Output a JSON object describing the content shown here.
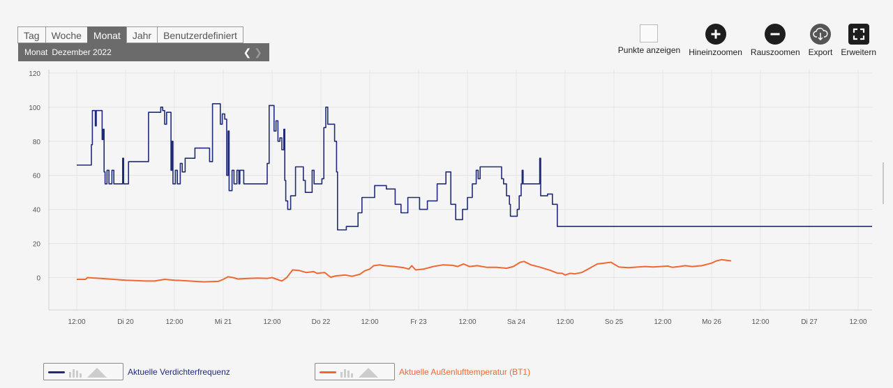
{
  "tabs": [
    "Tag",
    "Woche",
    "Monat",
    "Jahr",
    "Benutzerdefiniert"
  ],
  "active_tab": "Monat",
  "period": {
    "label": "Monat",
    "value": "Dezember 2022"
  },
  "tools": {
    "show_points": "Punkte anzeigen",
    "zoom_in": "Hineinzoomen",
    "zoom_out": "Rauszoomen",
    "export": "Export",
    "expand": "Erweitern"
  },
  "chart_data": {
    "type": "line",
    "y_ticks": [
      120,
      100,
      80,
      60,
      40,
      20,
      0
    ],
    "ylim": [
      -19,
      122
    ],
    "x_tick_labels": [
      "12:00",
      "Di 20",
      "12:00",
      "Mi 21",
      "12:00",
      "Do 22",
      "12:00",
      "Fr 23",
      "12:00",
      "Sa 24",
      "12:00",
      "So 25",
      "12:00",
      "Mo 26",
      "12:00",
      "Di 27",
      "12:00"
    ],
    "grid": true,
    "legend_position": "bottom-left",
    "series": [
      {
        "name": "Aktuelle Verdichterfrequenz",
        "color": "#1f2a78",
        "step": true,
        "points": [
          [
            0,
            66
          ],
          [
            0.26,
            66
          ],
          [
            0.3,
            78
          ],
          [
            0.32,
            98
          ],
          [
            0.36,
            98
          ],
          [
            0.38,
            89
          ],
          [
            0.4,
            98
          ],
          [
            0.5,
            98
          ],
          [
            0.52,
            81
          ],
          [
            0.54,
            87
          ],
          [
            0.56,
            62
          ],
          [
            0.58,
            55
          ],
          [
            0.62,
            63
          ],
          [
            0.66,
            55
          ],
          [
            0.72,
            63
          ],
          [
            0.76,
            55
          ],
          [
            0.92,
            55
          ],
          [
            0.94,
            70
          ],
          [
            0.96,
            55
          ],
          [
            1.02,
            55
          ],
          [
            1.06,
            68
          ],
          [
            1.45,
            68
          ],
          [
            1.47,
            97
          ],
          [
            1.7,
            97
          ],
          [
            1.72,
            100
          ],
          [
            1.76,
            98
          ],
          [
            1.8,
            90
          ],
          [
            1.84,
            97
          ],
          [
            1.9,
            97
          ],
          [
            1.93,
            63
          ],
          [
            1.95,
            80
          ],
          [
            1.97,
            55
          ],
          [
            2.02,
            63
          ],
          [
            2.06,
            55
          ],
          [
            2.12,
            67
          ],
          [
            2.16,
            62
          ],
          [
            2.22,
            70
          ],
          [
            2.4,
            70
          ],
          [
            2.42,
            76
          ],
          [
            2.68,
            76
          ],
          [
            2.72,
            68
          ],
          [
            2.76,
            68
          ],
          [
            2.78,
            102
          ],
          [
            2.92,
            102
          ],
          [
            2.94,
            90
          ],
          [
            2.98,
            96
          ],
          [
            3.03,
            93
          ],
          [
            3.07,
            60
          ],
          [
            3.1,
            86
          ],
          [
            3.12,
            51
          ],
          [
            3.18,
            63
          ],
          [
            3.22,
            55
          ],
          [
            3.28,
            63
          ],
          [
            3.32,
            55
          ],
          [
            3.34,
            63
          ],
          [
            3.38,
            63
          ],
          [
            3.42,
            55
          ],
          [
            3.88,
            55
          ],
          [
            3.9,
            67
          ],
          [
            3.94,
            101
          ],
          [
            4.0,
            101
          ],
          [
            4.04,
            86
          ],
          [
            4.08,
            92
          ],
          [
            4.12,
            80
          ],
          [
            4.16,
            82
          ],
          [
            4.2,
            75
          ],
          [
            4.24,
            87
          ],
          [
            4.26,
            57
          ],
          [
            4.28,
            45
          ],
          [
            4.32,
            40
          ],
          [
            4.38,
            48
          ],
          [
            4.46,
            48
          ],
          [
            4.48,
            65
          ],
          [
            4.62,
            65
          ],
          [
            4.64,
            57
          ],
          [
            4.68,
            50
          ],
          [
            4.8,
            50
          ],
          [
            4.82,
            63
          ],
          [
            4.86,
            55
          ],
          [
            5.0,
            55
          ],
          [
            5.02,
            58
          ],
          [
            5.06,
            88
          ],
          [
            5.1,
            100
          ],
          [
            5.14,
            90
          ],
          [
            5.24,
            90
          ],
          [
            5.28,
            80
          ],
          [
            5.32,
            62
          ],
          [
            5.34,
            28
          ],
          [
            5.5,
            28
          ],
          [
            5.52,
            30
          ],
          [
            5.74,
            30
          ],
          [
            5.76,
            38
          ],
          [
            5.84,
            47
          ],
          [
            6.06,
            47
          ],
          [
            6.1,
            54
          ],
          [
            6.32,
            54
          ],
          [
            6.34,
            52
          ],
          [
            6.5,
            52
          ],
          [
            6.52,
            43
          ],
          [
            6.62,
            43
          ],
          [
            6.64,
            38
          ],
          [
            6.76,
            38
          ],
          [
            6.78,
            47
          ],
          [
            7.0,
            47
          ],
          [
            7.02,
            40
          ],
          [
            7.16,
            40
          ],
          [
            7.18,
            45
          ],
          [
            7.36,
            45
          ],
          [
            7.38,
            55
          ],
          [
            7.54,
            55
          ],
          [
            7.56,
            62
          ],
          [
            7.64,
            62
          ],
          [
            7.66,
            43
          ],
          [
            7.74,
            43
          ],
          [
            7.76,
            34
          ],
          [
            7.88,
            34
          ],
          [
            7.9,
            40
          ],
          [
            7.98,
            40
          ],
          [
            8.0,
            47
          ],
          [
            8.08,
            47
          ],
          [
            8.1,
            55
          ],
          [
            8.16,
            55
          ],
          [
            8.18,
            63
          ],
          [
            8.22,
            58
          ],
          [
            8.26,
            65
          ],
          [
            8.68,
            65
          ],
          [
            8.7,
            58
          ],
          [
            8.74,
            55
          ],
          [
            8.8,
            48
          ],
          [
            8.86,
            43
          ],
          [
            8.88,
            36
          ],
          [
            8.98,
            36
          ],
          [
            9.02,
            40
          ],
          [
            9.06,
            48
          ],
          [
            9.1,
            55
          ],
          [
            9.12,
            63
          ],
          [
            9.14,
            55
          ],
          [
            9.46,
            55
          ],
          [
            9.48,
            70
          ],
          [
            9.5,
            48
          ],
          [
            9.62,
            48
          ],
          [
            9.64,
            49
          ],
          [
            9.72,
            49
          ],
          [
            9.74,
            43
          ],
          [
            9.82,
            43
          ],
          [
            9.84,
            30
          ],
          [
            9.98,
            30
          ]
        ]
      },
      {
        "name": "Aktuelle Außenlufttemperatur (BT1)",
        "color": "#f26730",
        "step": false,
        "points": [
          [
            0,
            -1
          ],
          [
            0.18,
            -1
          ],
          [
            0.22,
            0
          ],
          [
            0.5,
            -0.5
          ],
          [
            1.0,
            -1.5
          ],
          [
            1.4,
            -2
          ],
          [
            1.6,
            -2
          ],
          [
            1.8,
            -1
          ],
          [
            2.0,
            -1.5
          ],
          [
            2.3,
            -2
          ],
          [
            2.6,
            -2.5
          ],
          [
            2.9,
            -2.2
          ],
          [
            3.0,
            -1
          ],
          [
            3.1,
            0.5
          ],
          [
            3.2,
            0
          ],
          [
            3.3,
            -0.8
          ],
          [
            3.5,
            -0.5
          ],
          [
            3.7,
            -0.3
          ],
          [
            3.9,
            -0.5
          ],
          [
            4.0,
            0
          ],
          [
            4.1,
            -1
          ],
          [
            4.2,
            -2
          ],
          [
            4.3,
            0
          ],
          [
            4.42,
            4.5
          ],
          [
            4.55,
            4.2
          ],
          [
            4.7,
            3
          ],
          [
            4.85,
            3.5
          ],
          [
            4.92,
            2.5
          ],
          [
            5.0,
            2.8
          ],
          [
            5.08,
            3
          ],
          [
            5.14,
            1.5
          ],
          [
            5.2,
            0.2
          ],
          [
            5.3,
            1
          ],
          [
            5.5,
            1.5
          ],
          [
            5.64,
            0.8
          ],
          [
            5.8,
            2
          ],
          [
            5.9,
            4
          ],
          [
            6.0,
            5
          ],
          [
            6.08,
            7
          ],
          [
            6.2,
            7.5
          ],
          [
            6.3,
            7
          ],
          [
            6.5,
            6.5
          ],
          [
            6.7,
            5.8
          ],
          [
            6.8,
            5
          ],
          [
            6.86,
            7
          ],
          [
            6.94,
            4.5
          ],
          [
            7.1,
            5
          ],
          [
            7.3,
            6.5
          ],
          [
            7.5,
            7.5
          ],
          [
            7.7,
            7.2
          ],
          [
            7.8,
            6.5
          ],
          [
            7.92,
            8
          ],
          [
            8.04,
            6.5
          ],
          [
            8.2,
            7
          ],
          [
            8.4,
            6
          ],
          [
            8.6,
            6
          ],
          [
            8.8,
            5.5
          ],
          [
            8.94,
            6.5
          ],
          [
            9.08,
            9
          ],
          [
            9.16,
            9.5
          ],
          [
            9.3,
            7.5
          ],
          [
            9.5,
            6
          ],
          [
            9.7,
            4.2
          ],
          [
            9.84,
            2.6
          ],
          [
            9.94,
            2.5
          ],
          [
            10.0,
            1.5
          ],
          [
            10.1,
            2.5
          ],
          [
            10.2,
            2.2
          ],
          [
            10.34,
            3
          ],
          [
            10.5,
            5.5
          ],
          [
            10.66,
            8
          ],
          [
            10.8,
            8.5
          ],
          [
            10.94,
            9
          ],
          [
            11.1,
            6.2
          ],
          [
            11.3,
            5.8
          ],
          [
            11.5,
            6.2
          ],
          [
            11.64,
            6.5
          ],
          [
            11.8,
            6.2
          ],
          [
            11.96,
            6.5
          ],
          [
            12.1,
            6.8
          ],
          [
            12.2,
            6
          ],
          [
            12.34,
            6.5
          ],
          [
            12.46,
            7
          ],
          [
            12.6,
            6.5
          ],
          [
            12.8,
            7
          ],
          [
            13.0,
            8.5
          ],
          [
            13.1,
            9.8
          ],
          [
            13.2,
            10.5
          ],
          [
            13.3,
            10.2
          ],
          [
            13.4,
            9.8
          ]
        ]
      }
    ]
  }
}
